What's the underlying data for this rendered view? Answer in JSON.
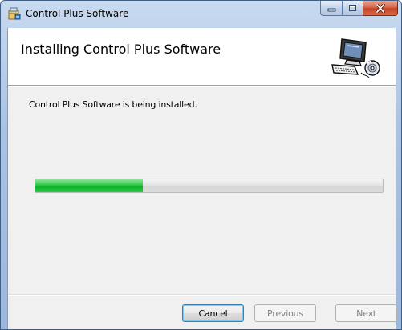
{
  "window": {
    "title": "Control Plus Software",
    "icon": "installer-icon"
  },
  "caption_buttons": {
    "minimize_icon": "minimize-icon",
    "maximize_icon": "maximize-icon",
    "close_icon": "close-icon"
  },
  "banner": {
    "title": "Installing Control Plus Software",
    "art_icon": "computer-cd-icon"
  },
  "status": {
    "message": "Control Plus Software is being installed."
  },
  "progress": {
    "fraction": 0.31,
    "fill_color": "#06b025"
  },
  "buttons": {
    "cancel_label": "Cancel",
    "previous_label": "Previous",
    "next_label": "Next"
  }
}
